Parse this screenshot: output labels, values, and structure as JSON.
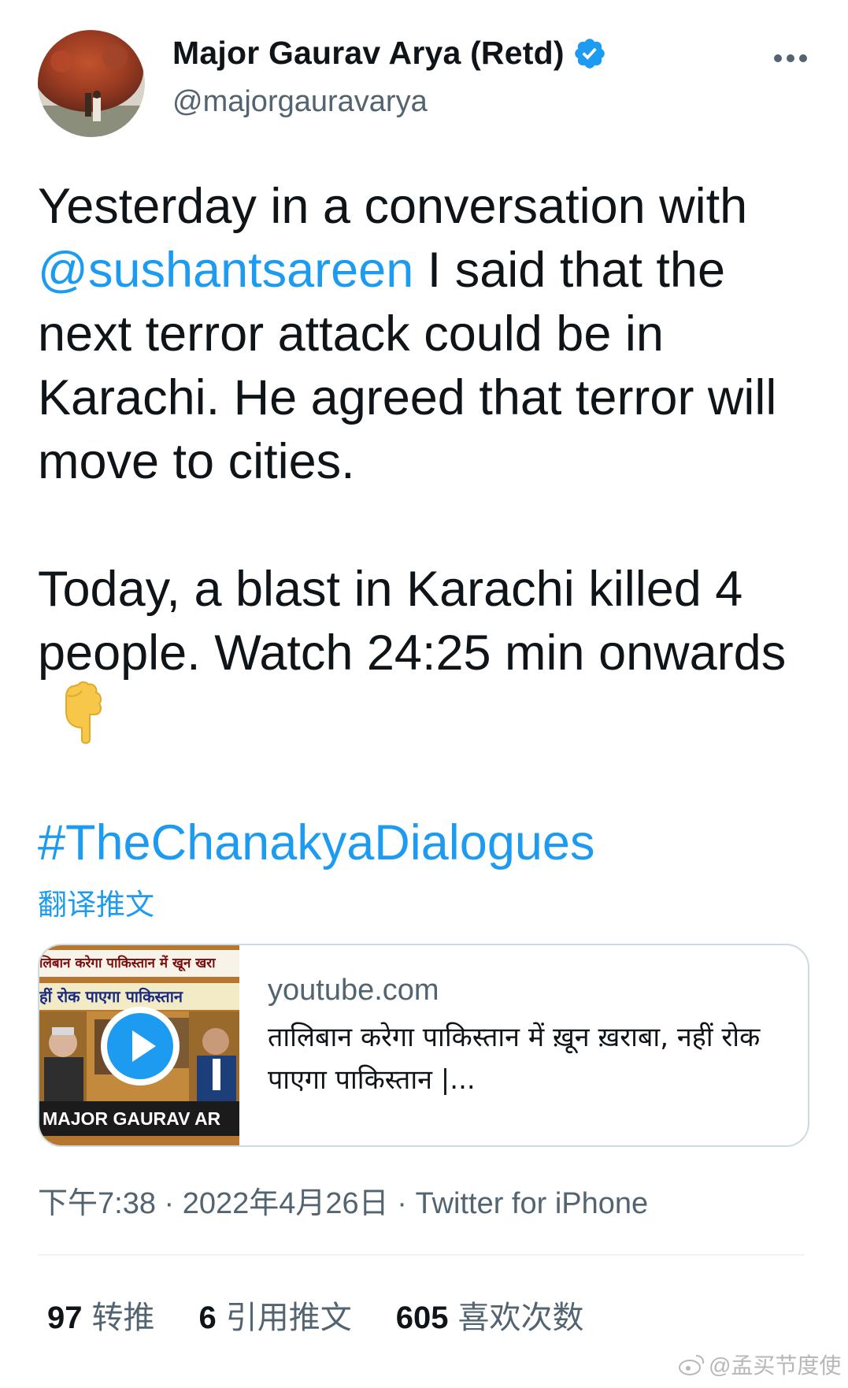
{
  "author": {
    "display_name": "Major Gaurav Arya (Retd)",
    "handle": "@majorgauravarya"
  },
  "tweet": {
    "p1_before": "Yesterday in a conversation with ",
    "mention": "@sushantsareen",
    "p1_after": " I said that the next terror attack could be in Karachi. He agreed that terror will move to cities.",
    "p2": "Today, a blast in Karachi killed 4 people. Watch 24:25 min onwards",
    "hashtag": "#TheChanakyaDialogues",
    "translate_label": "翻译推文"
  },
  "card": {
    "thumb_line1": "लिबान करेगा पाकिस्तान में खून खरा",
    "thumb_line2": "हीं रोक पाएगा पाकिस्तान",
    "thumb_footer": "MAJOR GAURAV AR",
    "domain": "youtube.com",
    "title": "तालिबान करेगा पाकिस्तान में ख़ून ख़राबा, नहीं रोक पाएगा पाकिस्तान |..."
  },
  "meta": {
    "time": "下午7:38",
    "date": "2022年4月26日",
    "source": "Twitter for iPhone",
    "separator": " · "
  },
  "stats": [
    {
      "count": "97",
      "label": "转推"
    },
    {
      "count": "6",
      "label": "引用推文"
    },
    {
      "count": "605",
      "label": "喜欢次数"
    }
  ],
  "watermark": "@孟买节度使",
  "colors": {
    "link": "#1d9bf0",
    "text": "#0f1419",
    "secondary": "#536471",
    "border": "#cfd9de"
  },
  "icons": {
    "verified": "verified-badge-icon",
    "more": "more-dots-icon",
    "point": "backhand-index-pointing-down-emoji",
    "play": "play-icon",
    "weibo": "weibo-icon"
  }
}
